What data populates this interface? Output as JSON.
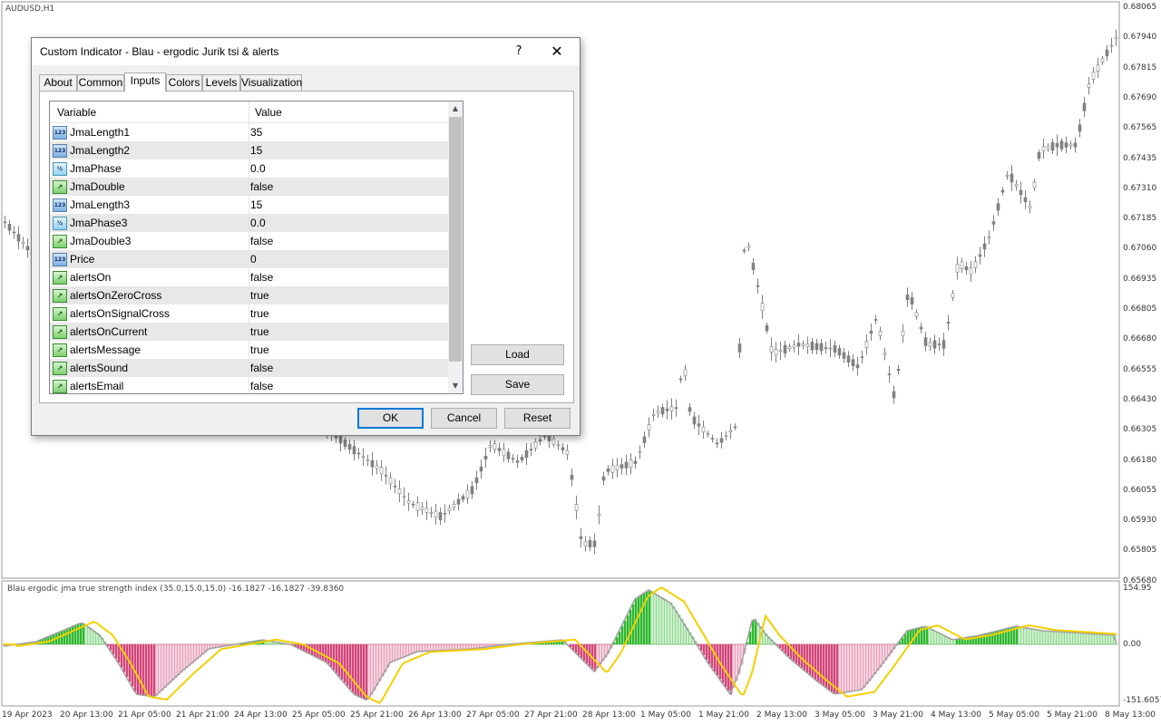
{
  "chart": {
    "symbol_label": "AUDUSD,H1",
    "indicator_label": "Blau ergodic jma true strength index (35.0,15.0,15.0) -16.1827 -16.1827 -39.8360",
    "price_axis": [
      "0.68065",
      "0.67940",
      "0.67815",
      "0.67690",
      "0.67565",
      "0.67435",
      "0.67310",
      "0.67185",
      "0.67060",
      "0.66935",
      "0.66805",
      "0.66680",
      "0.66555",
      "0.66430",
      "0.66305",
      "0.66180",
      "0.66055",
      "0.65930",
      "0.65805",
      "0.65680"
    ],
    "indicator_axis": [
      "154.95",
      "0.00",
      "-151.6057"
    ],
    "time_axis": [
      "19 Apr 2023",
      "20 Apr 13:00",
      "21 Apr 05:00",
      "21 Apr 21:00",
      "24 Apr 13:00",
      "25 Apr 05:00",
      "25 Apr 21:00",
      "26 Apr 13:00",
      "27 Apr 05:00",
      "27 Apr 21:00",
      "28 Apr 13:00",
      "1 May 05:00",
      "1 May 21:00",
      "2 May 13:00",
      "3 May 05:00",
      "3 May 21:00",
      "4 May 13:00",
      "5 May 05:00",
      "5 May 21:00",
      "8 May 13:00"
    ],
    "colors": {
      "bull_hist": "#2fb82f",
      "bear_hist": "#d2477a",
      "signal_line": "#f5d000",
      "tsi_line": "#a0a0a0",
      "candle": "#808080"
    }
  },
  "dialog": {
    "title": "Custom Indicator - Blau - ergodic Jurik tsi & alerts",
    "help": "?",
    "close": "✕",
    "tabs": [
      "About",
      "Common",
      "Inputs",
      "Colors",
      "Levels",
      "Visualization"
    ],
    "active_tab": "Inputs",
    "grid": {
      "col_variable": "Variable",
      "col_value": "Value",
      "rows": [
        {
          "icon": "123",
          "type": "int",
          "name": "JmaLength1",
          "value": "35"
        },
        {
          "icon": "123",
          "type": "int",
          "name": "JmaLength2",
          "value": "15"
        },
        {
          "icon": "½",
          "type": "frac",
          "name": "JmaPhase",
          "value": "0.0"
        },
        {
          "icon": "↗",
          "type": "bool",
          "name": "JmaDouble",
          "value": "false"
        },
        {
          "icon": "123",
          "type": "int",
          "name": "JmaLength3",
          "value": "15"
        },
        {
          "icon": "½",
          "type": "frac",
          "name": "JmaPhase3",
          "value": "0.0"
        },
        {
          "icon": "↗",
          "type": "bool",
          "name": "JmaDouble3",
          "value": "false"
        },
        {
          "icon": "123",
          "type": "int",
          "name": "Price",
          "value": "0"
        },
        {
          "icon": "↗",
          "type": "bool",
          "name": "alertsOn",
          "value": "false"
        },
        {
          "icon": "↗",
          "type": "bool",
          "name": "alertsOnZeroCross",
          "value": "true"
        },
        {
          "icon": "↗",
          "type": "bool",
          "name": "alertsOnSignalCross",
          "value": "true"
        },
        {
          "icon": "↗",
          "type": "bool",
          "name": "alertsOnCurrent",
          "value": "true"
        },
        {
          "icon": "↗",
          "type": "bool",
          "name": "alertsMessage",
          "value": "true"
        },
        {
          "icon": "↗",
          "type": "bool",
          "name": "alertsSound",
          "value": "false"
        },
        {
          "icon": "↗",
          "type": "bool",
          "name": "alertsEmail",
          "value": "false"
        }
      ]
    },
    "buttons": {
      "load": "Load",
      "save": "Save",
      "ok": "OK",
      "cancel": "Cancel",
      "reset": "Reset"
    }
  }
}
